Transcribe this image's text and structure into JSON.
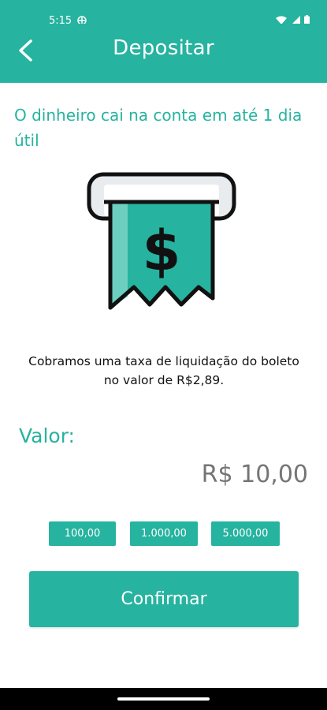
{
  "status_bar": {
    "time": "5:15",
    "icons": [
      "settings-icon",
      "wifi-icon",
      "signal-icon",
      "battery-icon"
    ]
  },
  "header": {
    "title": "Depositar",
    "back_icon": "chevron-left-icon"
  },
  "main": {
    "headline": "O dinheiro cai na conta em até 1 dia útil",
    "illustration_icon": "receipt-dollar-icon",
    "fee_note": "Cobramos uma taxa de liquidação do boleto no valor de R$2,89.",
    "valor_label": "Valor:",
    "amount": "R$ 10,00",
    "quick_amounts": [
      "100,00",
      "1.000,00",
      "5.000,00"
    ],
    "confirm_label": "Confirmar"
  },
  "colors": {
    "primary": "#26b3a0",
    "amount_text": "#757575"
  }
}
